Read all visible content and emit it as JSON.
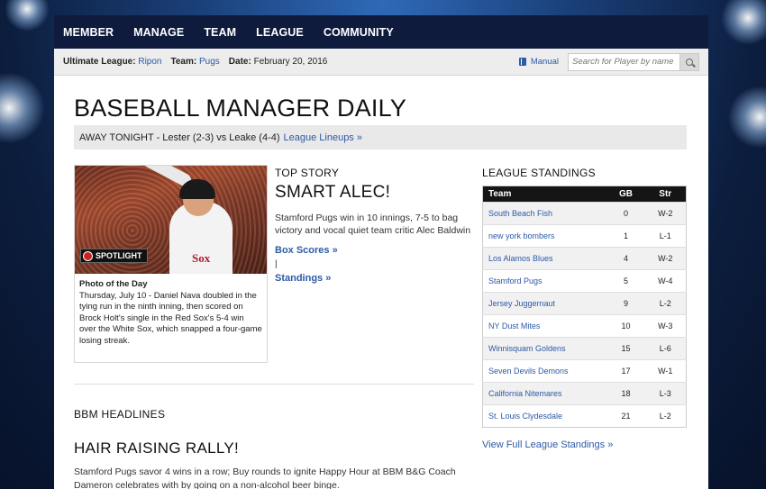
{
  "nav": [
    "MEMBER",
    "MANAGE",
    "TEAM",
    "LEAGUE",
    "COMMUNITY"
  ],
  "subbar": {
    "league_label": "Ultimate League:",
    "league_value": "Ripon",
    "team_label": "Team:",
    "team_value": "Pugs",
    "date_label": "Date:",
    "date_value": "February 20, 2016",
    "manual": "Manual",
    "search_placeholder": "Search for Player by name"
  },
  "title": "BASEBALL MANAGER DAILY",
  "tonight": {
    "text": "AWAY TONIGHT - Lester (2-3) vs Leake (4-4)",
    "link": "League Lineups »"
  },
  "photo": {
    "spotlight": "SPOTLIGHT",
    "jersey_text": "Sox",
    "caption_title": "Photo of the Day",
    "caption": "Thursday, July 10 - Daniel Nava doubled in the tying run in the ninth inning, then scored on Brock Holt's single in the Red Sox's 5-4 win over the White Sox, which snapped a four-game losing streak."
  },
  "top_story": {
    "label": "TOP STORY",
    "title": "SMART ALEC!",
    "body": "Stamford Pugs win in 10 innings, 7-5 to bag victory and vocal quiet team critic Alec Baldwin",
    "box_scores": "Box Scores »",
    "pipe": "|",
    "standings_link": "Standings »"
  },
  "headlines": {
    "label": "BBM HEADLINES",
    "title": "HAIR RAISING RALLY!",
    "body": "Stamford Pugs savor 4 wins in a row; Buy rounds to ignite Happy Hour at BBM B&G Coach Dameron celebrates with by going on a non-alcohol beer binge."
  },
  "standings": {
    "label": "LEAGUE STANDINGS",
    "headers": [
      "Team",
      "GB",
      "Str"
    ],
    "rows": [
      {
        "team": "South Beach Fish",
        "gb": "0",
        "str": "W-2"
      },
      {
        "team": "new york bombers",
        "gb": "1",
        "str": "L-1"
      },
      {
        "team": "Los Alamos Blues",
        "gb": "4",
        "str": "W-2"
      },
      {
        "team": "Stamford Pugs",
        "gb": "5",
        "str": "W-4"
      },
      {
        "team": "Jersey Juggernaut",
        "gb": "9",
        "str": "L-2"
      },
      {
        "team": "NY Dust Mites",
        "gb": "10",
        "str": "W-3"
      },
      {
        "team": "Winnisquam Goldens",
        "gb": "15",
        "str": "L-6"
      },
      {
        "team": "Seven Devils Demons",
        "gb": "17",
        "str": "W-1"
      },
      {
        "team": "California Nitemares",
        "gb": "18",
        "str": "L-3"
      },
      {
        "team": "St. Louis Clydesdale",
        "gb": "21",
        "str": "L-2"
      }
    ],
    "view_full": "View Full League Standings »"
  },
  "colors": {
    "nav_bg": "#0e1b3d",
    "link": "#2d5aa6",
    "table_header": "#151515"
  }
}
